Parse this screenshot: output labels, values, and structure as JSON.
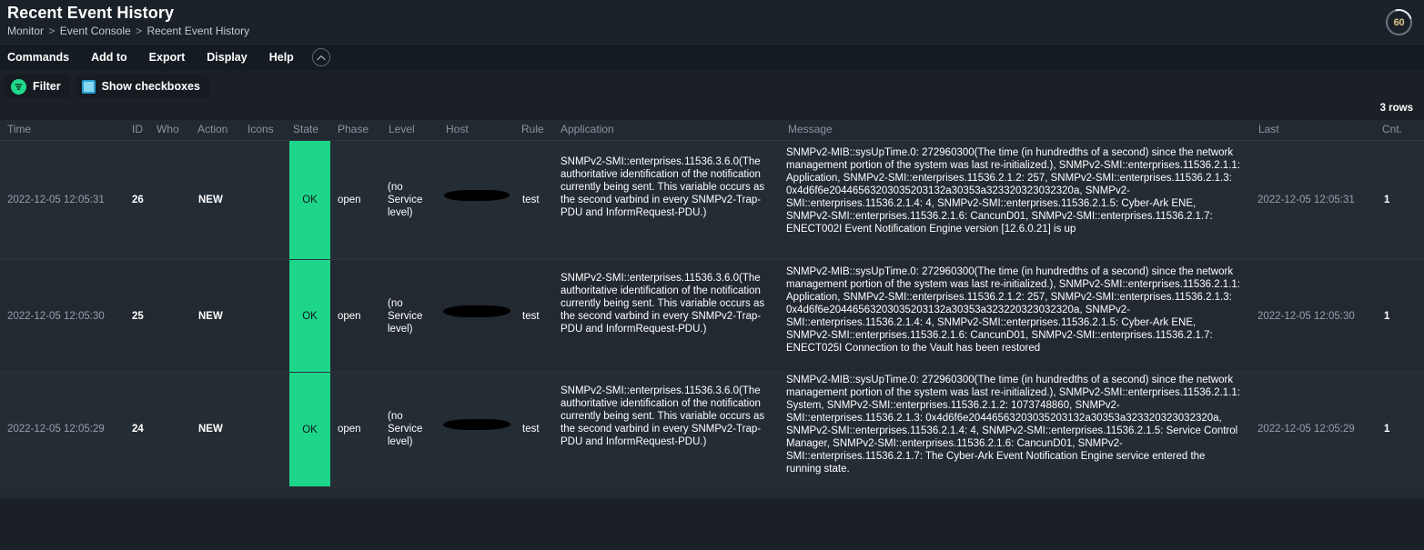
{
  "header": {
    "title": "Recent Event History",
    "breadcrumb": [
      "Monitor",
      "Event Console",
      "Recent Event History"
    ],
    "breadcrumb_separator": ">",
    "refresh_badge": {
      "value": "60",
      "icon": "refresh-countdown-icon"
    }
  },
  "menubar": {
    "items": [
      "Commands",
      "Add to",
      "Export",
      "Display",
      "Help"
    ],
    "collapse_icon": "chevron-up-circle-icon"
  },
  "toolbar": {
    "filter_label": "Filter",
    "filter_icon": "filter-icon",
    "checkbox_label": "Show checkboxes",
    "checkbox_icon": "checkbox-checked-icon"
  },
  "table": {
    "rowcount_label": "3 rows",
    "columns": [
      {
        "key": "time",
        "label": "Time"
      },
      {
        "key": "id",
        "label": "ID"
      },
      {
        "key": "who",
        "label": "Who"
      },
      {
        "key": "action",
        "label": "Action"
      },
      {
        "key": "icons",
        "label": "Icons"
      },
      {
        "key": "state",
        "label": "State"
      },
      {
        "key": "phase",
        "label": "Phase"
      },
      {
        "key": "level",
        "label": "Level"
      },
      {
        "key": "host",
        "label": "Host"
      },
      {
        "key": "rule",
        "label": "Rule"
      },
      {
        "key": "application",
        "label": "Application"
      },
      {
        "key": "message",
        "label": "Message"
      },
      {
        "key": "last",
        "label": "Last"
      },
      {
        "key": "cnt",
        "label": "Cnt."
      }
    ],
    "rows": [
      {
        "time": "2022-12-05 12:05:31",
        "id": "26",
        "who": "",
        "action": "NEW",
        "icons": "",
        "state": "OK",
        "phase": "open",
        "level": "(no Service level)",
        "host": "",
        "host_redacted": true,
        "rule": "test",
        "application": "SNMPv2-SMI::enterprises.11536.3.6.0(The authoritative identification of the notification currently being sent. This variable occurs as the second varbind in every SNMPv2-Trap-PDU and InformRequest-PDU.)",
        "message": "SNMPv2-MIB::sysUpTime.0: 272960300(The time (in hundredths of a second) since the network management portion of the system was last re-initialized.), SNMPv2-SMI::enterprises.11536.2.1.1: Application, SNMPv2-SMI::enterprises.11536.2.1.2: 257, SNMPv2-SMI::enterprises.11536.2.1.3: 0x4d6f6e20446563203035203132a30353a323320323032320a, SNMPv2-SMI::enterprises.11536.2.1.4: 4, SNMPv2-SMI::enterprises.11536.2.1.5: Cyber-Ark ENE, SNMPv2-SMI::enterprises.11536.2.1.6: CancunD01, SNMPv2-SMI::enterprises.11536.2.1.7: ENECT002I Event Notification Engine version [12.6.0.21] is up",
        "last": "2022-12-05 12:05:31",
        "cnt": "1"
      },
      {
        "time": "2022-12-05 12:05:30",
        "id": "25",
        "who": "",
        "action": "NEW",
        "icons": "",
        "state": "OK",
        "phase": "open",
        "level": "(no Service level)",
        "host": "",
        "host_redacted": true,
        "rule": "test",
        "application": "SNMPv2-SMI::enterprises.11536.3.6.0(The authoritative identification of the notification currently being sent. This variable occurs as the second varbind in every SNMPv2-Trap-PDU and InformRequest-PDU.)",
        "message": "SNMPv2-MIB::sysUpTime.0: 272960300(The time (in hundredths of a second) since the network management portion of the system was last re-initialized.), SNMPv2-SMI::enterprises.11536.2.1.1: Application, SNMPv2-SMI::enterprises.11536.2.1.2: 257, SNMPv2-SMI::enterprises.11536.2.1.3: 0x4d6f6e20446563203035203132a30353a323220323032320a, SNMPv2-SMI::enterprises.11536.2.1.4: 4, SNMPv2-SMI::enterprises.11536.2.1.5: Cyber-Ark ENE, SNMPv2-SMI::enterprises.11536.2.1.6: CancunD01, SNMPv2-SMI::enterprises.11536.2.1.7: ENECT025I Connection to the Vault has been restored",
        "last": "2022-12-05 12:05:30",
        "cnt": "1"
      },
      {
        "time": "2022-12-05 12:05:29",
        "id": "24",
        "who": "",
        "action": "NEW",
        "icons": "",
        "state": "OK",
        "phase": "open",
        "level": "(no Service level)",
        "host": "",
        "host_redacted": true,
        "rule": "test",
        "application": "SNMPv2-SMI::enterprises.11536.3.6.0(The authoritative identification of the notification currently being sent. This variable occurs as the second varbind in every SNMPv2-Trap-PDU and InformRequest-PDU.)",
        "message": "SNMPv2-MIB::sysUpTime.0: 272960300(The time (in hundredths of a second) since the network management portion of the system was last re-initialized.), SNMPv2-SMI::enterprises.11536.2.1.1: System, SNMPv2-SMI::enterprises.11536.2.1.2: 1073748860, SNMPv2-SMI::enterprises.11536.2.1.3: 0x4d6f6e20446563203035203132a30353a323320323032320a, SNMPv2-SMI::enterprises.11536.2.1.4: 4, SNMPv2-SMI::enterprises.11536.2.1.5: Service Control Manager, SNMPv2-SMI::enterprises.11536.2.1.6: CancunD01, SNMPv2-SMI::enterprises.11536.2.1.7: The Cyber-Ark Event Notification Engine service entered the running state.",
        "last": "2022-12-05 12:05:29",
        "cnt": "1"
      }
    ]
  },
  "colors": {
    "state_ok": "#1dd68a",
    "page_bg": "#1b2027",
    "row_bg": "#242c34",
    "row_bg_alt": "#222931",
    "filter_accent": "#1fd98c",
    "checkbox_accent": "#86d7ef"
  }
}
